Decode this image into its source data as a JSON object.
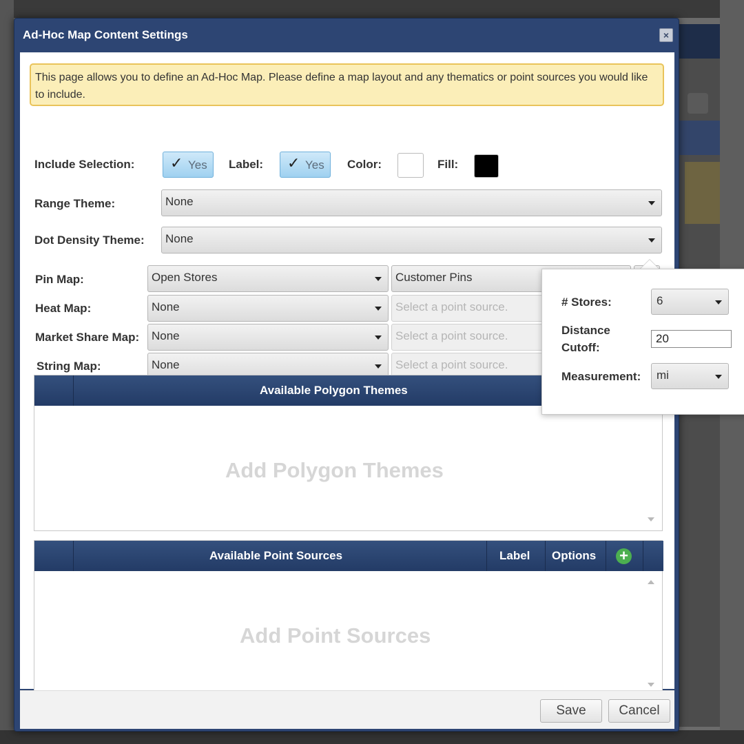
{
  "dialog": {
    "title": "Ad-Hoc Map Content Settings",
    "close_symbol": "×",
    "info": "This page allows you to define an Ad-Hoc Map. Please define a map layout and any thematics or point sources you would like to include."
  },
  "selection_row": {
    "include_label": "Include Selection:",
    "include_value": "Yes",
    "label_label": "Label:",
    "label_value": "Yes",
    "color_label": "Color:",
    "color_value": "#ffffff",
    "fill_label": "Fill:",
    "fill_value": "#000000",
    "check_glyph": "✓"
  },
  "range_theme": {
    "label": "Range Theme:",
    "value": "None"
  },
  "dot_density_theme": {
    "label": "Dot Density Theme:",
    "value": "None"
  },
  "map_rows": [
    {
      "label": "Pin Map:",
      "value": "Open Stores",
      "source": "Customer Pins",
      "source_placeholder": false
    },
    {
      "label": "Heat Map:",
      "value": "None",
      "source": "Select a point source.",
      "source_placeholder": true
    },
    {
      "label": "Market Share Map:",
      "value": "None",
      "source": "Select a point source.",
      "source_placeholder": true
    },
    {
      "label": "String Map:",
      "value": "None",
      "source": "Select a point source.",
      "source_placeholder": true
    }
  ],
  "polygon_grid": {
    "header": "Available Polygon Themes",
    "placeholder": "Add Polygon Themes"
  },
  "point_grid": {
    "header": "Available Point Sources",
    "col_label": "Label",
    "col_options": "Options",
    "add_symbol": "+",
    "placeholder": "Add Point Sources"
  },
  "popover": {
    "stores_label": "# Stores:",
    "stores_value": "6",
    "distance_label_1": "Distance",
    "distance_label_2": "Cutoff:",
    "distance_value": "20",
    "measurement_label": "Measurement:",
    "measurement_value": "mi"
  },
  "footer": {
    "save": "Save",
    "cancel": "Cancel"
  },
  "colors": {
    "title_bar": "#2d4573",
    "grid_header": "#233b66",
    "info_bg": "#fbeeb8",
    "info_border": "#e9c35a",
    "add_green": "#4caf50"
  }
}
